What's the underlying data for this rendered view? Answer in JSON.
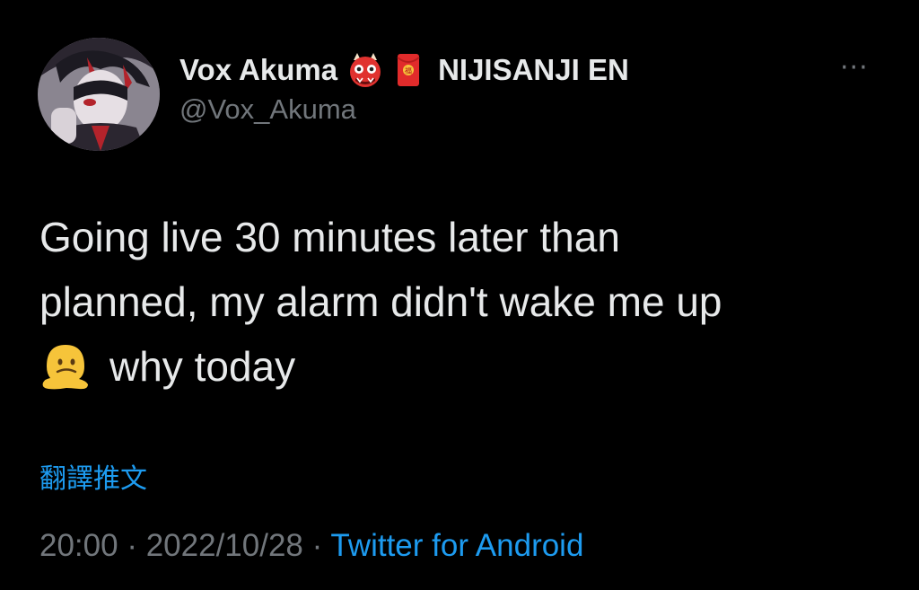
{
  "author": {
    "display_name": "Vox Akuma",
    "badge_emoji_1": "ogre-emoji",
    "badge_emoji_2": "red-envelope-emoji",
    "affiliation": "NIJISANJI EN",
    "handle": "@Vox_Akuma"
  },
  "more_menu": "···",
  "tweet": {
    "line1": "Going live 30 minutes later than",
    "line2": "planned, my alarm didn't wake me up",
    "line3_emoji": "melting-face-emoji",
    "line3": "why today"
  },
  "translate_label": "翻譯推文",
  "meta": {
    "time": "20:00",
    "separator": " · ",
    "date": "2022/10/28",
    "separator2": " · ",
    "source": "Twitter for Android"
  },
  "colors": {
    "background": "#000000",
    "text": "#e7e9ea",
    "secondary": "#71767b",
    "link": "#1d9bf0"
  }
}
